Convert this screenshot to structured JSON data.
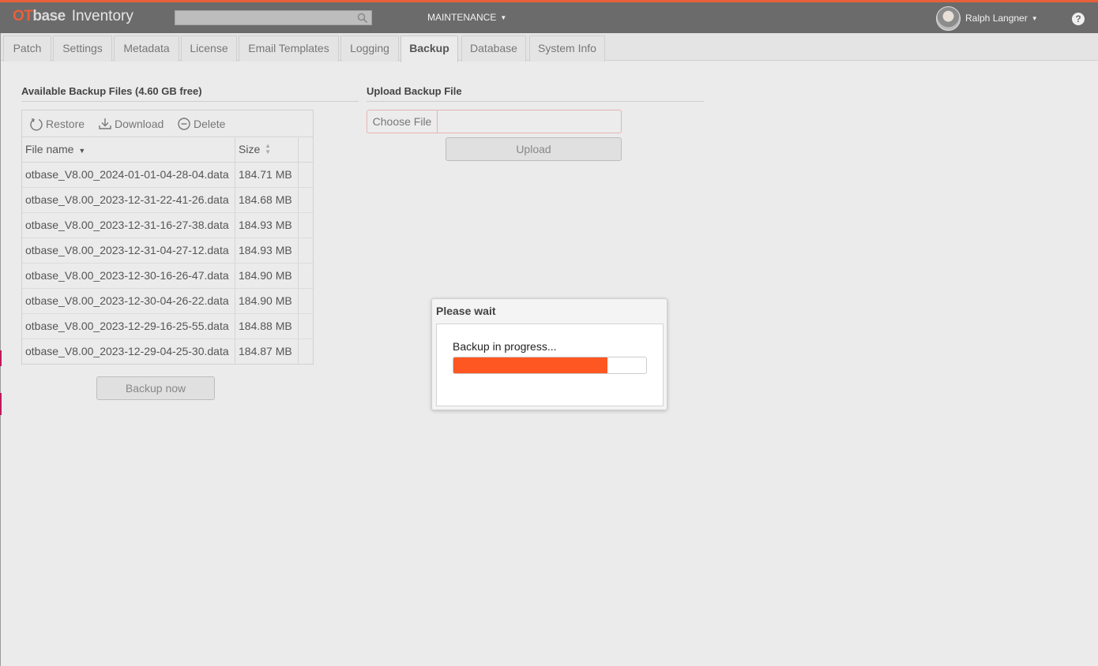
{
  "app": {
    "logo_ot": "OT",
    "logo_base": "base",
    "logo_product": "Inventory",
    "search_placeholder": "",
    "menu": "MAINTENANCE",
    "user_name": "Ralph Langner",
    "help": "?",
    "accent_color": "#e8603a"
  },
  "tabs": [
    {
      "label": "Patch",
      "active": false
    },
    {
      "label": "Settings",
      "active": false
    },
    {
      "label": "Metadata",
      "active": false
    },
    {
      "label": "License",
      "active": false
    },
    {
      "label": "Email Templates",
      "active": false
    },
    {
      "label": "Logging",
      "active": false
    },
    {
      "label": "Backup",
      "active": true
    },
    {
      "label": "Database",
      "active": false
    },
    {
      "label": "System Info",
      "active": false
    }
  ],
  "backups": {
    "title": "Available Backup Files (4.60 GB free)",
    "toolbar": {
      "restore": "Restore",
      "download": "Download",
      "delete": "Delete"
    },
    "columns": {
      "name": "File name",
      "size": "Size"
    },
    "rows": [
      {
        "name": "otbase_V8.00_2024-01-01-04-28-04.data",
        "size": "184.71 MB"
      },
      {
        "name": "otbase_V8.00_2023-12-31-22-41-26.data",
        "size": "184.68 MB"
      },
      {
        "name": "otbase_V8.00_2023-12-31-16-27-38.data",
        "size": "184.93 MB"
      },
      {
        "name": "otbase_V8.00_2023-12-31-04-27-12.data",
        "size": "184.93 MB"
      },
      {
        "name": "otbase_V8.00_2023-12-30-16-26-47.data",
        "size": "184.90 MB"
      },
      {
        "name": "otbase_V8.00_2023-12-30-04-26-22.data",
        "size": "184.90 MB"
      },
      {
        "name": "otbase_V8.00_2023-12-29-16-25-55.data",
        "size": "184.88 MB"
      },
      {
        "name": "otbase_V8.00_2023-12-29-04-25-30.data",
        "size": "184.87 MB"
      }
    ],
    "backup_button": "Backup now"
  },
  "upload": {
    "title": "Upload Backup File",
    "choose_file": "Choose File",
    "file_value": "",
    "upload_button": "Upload"
  },
  "dialog": {
    "title": "Please wait",
    "message": "Backup in progress...",
    "progress": 0.8,
    "progress_color": "#ff5722"
  }
}
